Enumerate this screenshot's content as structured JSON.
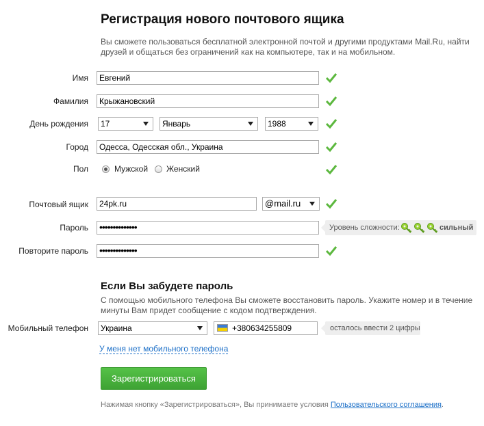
{
  "title": "Регистрация нового почтового ящика",
  "subtitle": "Вы сможете пользоваться бесплатной электронной почтой и другими продуктами Mail.Ru, найти друзей и общаться без ограничений как на компьютере, так и на мобильном.",
  "colors": {
    "check": "#5cb83e",
    "button": "#4cb440",
    "link": "#1a6ec7"
  },
  "form": {
    "first_name": {
      "label": "Имя",
      "value": "Евгений"
    },
    "last_name": {
      "label": "Фамилия",
      "value": "Крыжановский"
    },
    "birthday": {
      "label": "День рождения",
      "day": "17",
      "month": "Январь",
      "year": "1988"
    },
    "city": {
      "label": "Город",
      "value": "Одесса, Одесская обл., Украина"
    },
    "gender": {
      "label": "Пол",
      "male": "Мужской",
      "female": "Женский",
      "selected": "male"
    },
    "mailbox": {
      "label": "Почтовый ящик",
      "value": "24pk.ru",
      "domain": "@mail.ru"
    },
    "password": {
      "label": "Пароль",
      "value": "••••••••••••••"
    },
    "password_repeat": {
      "label": "Повторите пароль",
      "value": "••••••••••••••"
    },
    "strength": {
      "label": "Уровень сложности:",
      "value": "сильный",
      "level": 3,
      "max": 3,
      "icon": "key-icon"
    }
  },
  "recovery": {
    "title": "Если Вы забудете пароль",
    "text": "С помощью мобильного телефона Вы сможете восстановить пароль. Укажите номер и в течение минуты Вам придет сообщение с кодом подтверждения.",
    "phone_label": "Мобильный телефон",
    "country": "Украина",
    "phone": "+380634255809",
    "hint": "осталось ввести 2 цифры",
    "no_phone_link": "У меня нет мобильного телефона"
  },
  "submit_label": "Зарегистрироваться",
  "legal": {
    "text": "Нажимая кнопку «Зарегистрироваться», Вы принимаете условия ",
    "link": "Пользовательского соглашения",
    "end": "."
  }
}
